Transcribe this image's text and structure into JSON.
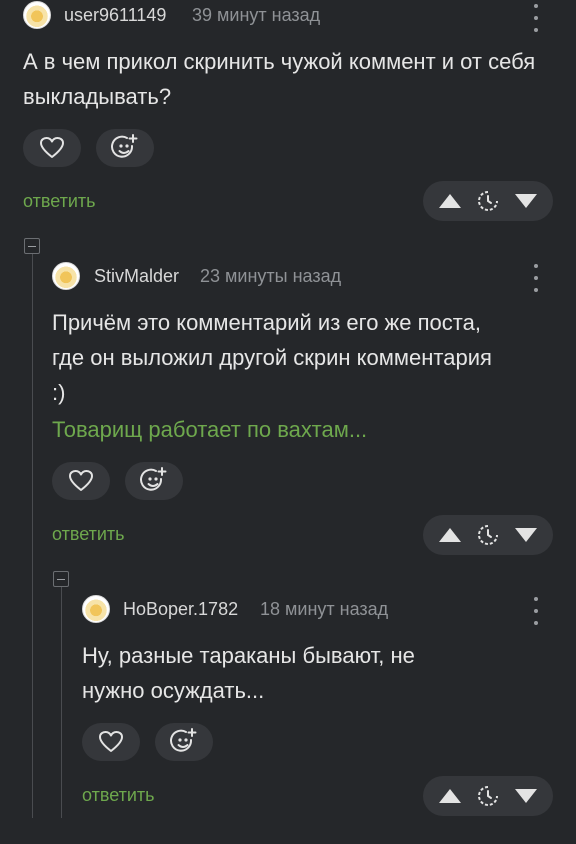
{
  "comments": [
    {
      "username": "user9611149",
      "time": "39 минут назад",
      "text": "А в чем прикол скринить чужой коммент и от себя выкладывать?",
      "reply": "ответить"
    },
    {
      "username": "StivMalder",
      "time": "23 минуты назад",
      "text": "Причём это комментарий из его же поста, где он выложил другой скрин комментария :)",
      "link": "Товарищ работает по вахтам...",
      "reply": "ответить"
    },
    {
      "username": "НоВорer.1782",
      "time": "18 минут назад",
      "text": "Ну, разные тараканы бывают, не нужно осуждать...",
      "reply": "ответить"
    }
  ],
  "colors": {
    "background": "#25272a",
    "pill": "#35373b",
    "accent": "#6ea84d"
  },
  "icons": [
    "heart-icon",
    "emoji-add-icon",
    "arrow-up-icon",
    "bookmark-clock-icon",
    "arrow-down-icon",
    "more-vertical-icon",
    "collapse-icon"
  ]
}
